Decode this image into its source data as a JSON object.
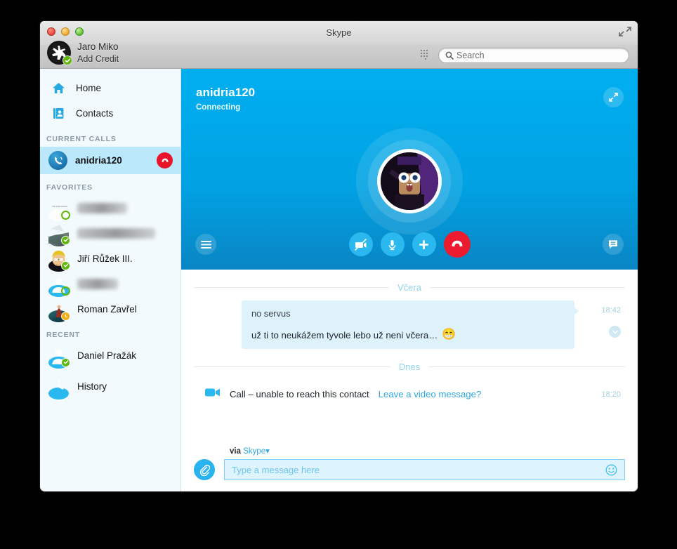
{
  "window": {
    "title": "Skype",
    "traffic_lights": [
      "close",
      "minimize",
      "maximize"
    ],
    "fullscreen_icon": "expand-diagonal-icon"
  },
  "profile": {
    "name": "Jaro Miko",
    "subtitle": "Add Credit",
    "avatar_icon": "aperture-logo-icon",
    "presence": "online",
    "presence_color": "#5fb709"
  },
  "search": {
    "placeholder": "Search",
    "icon": "search-icon",
    "dialpad_icon": "dialpad-icon"
  },
  "sidebar": {
    "nav": [
      {
        "label": "Home",
        "icon": "home-icon"
      },
      {
        "label": "Contacts",
        "icon": "contacts-book-icon"
      }
    ],
    "sections": [
      {
        "heading": "CURRENT CALLS"
      },
      {
        "heading": "FAVORITES"
      },
      {
        "heading": "RECENT"
      }
    ],
    "current_call": {
      "name": "anidria120",
      "icon": "incoming-call-icon",
      "hangup_icon": "hangup-icon",
      "hangup_color": "#e8152a",
      "highlight_color": "#bce8fb"
    },
    "favorites": [
      {
        "name": "",
        "redacted": true,
        "presence": "offline"
      },
      {
        "name": "",
        "redacted": true,
        "presence": "online"
      },
      {
        "name": "Jiří Růžek III.",
        "redacted": false,
        "presence": "online"
      },
      {
        "name": "",
        "redacted": true,
        "presence": "offline"
      },
      {
        "name": "Roman Zavřel",
        "redacted": false,
        "presence": "away"
      }
    ],
    "recent": [
      {
        "name": "Daniel Pražák",
        "redacted": false,
        "presence": "online"
      }
    ],
    "history": {
      "label": "History",
      "icon": "clock-icon"
    }
  },
  "call_panel": {
    "contact_name": "anidria120",
    "status": "Connecting",
    "expand_icon": "expand-icon",
    "accent_color": "#00aff0",
    "controls": {
      "menu_icon": "hamburger-menu-icon",
      "video_off_icon": "video-off-icon",
      "mic_icon": "microphone-icon",
      "add_icon": "add-plus-icon",
      "end_icon": "end-call-icon",
      "chat_icon": "chat-bubble-icon",
      "end_color": "#ec1b2e"
    }
  },
  "chat": {
    "days": [
      {
        "label": "Včera"
      },
      {
        "label": "Dnes"
      }
    ],
    "messages": [
      {
        "line1": "no servus",
        "line2": "už ti to neukážem tyvole lebo už neni včera…",
        "emoji": "😁",
        "timestamp": "18:42",
        "chevron_icon": "chevron-down-icon"
      }
    ],
    "events": [
      {
        "icon": "video-camera-icon",
        "text": "Call – unable to reach this contact",
        "link": "Leave a video message?",
        "timestamp": "18:20"
      }
    ]
  },
  "composer": {
    "via_label": "via",
    "via_value": "Skype",
    "via_caret": "▾",
    "attach_icon": "paperclip-icon",
    "placeholder": "Type a message here",
    "emoji_icon": "smiley-icon"
  }
}
